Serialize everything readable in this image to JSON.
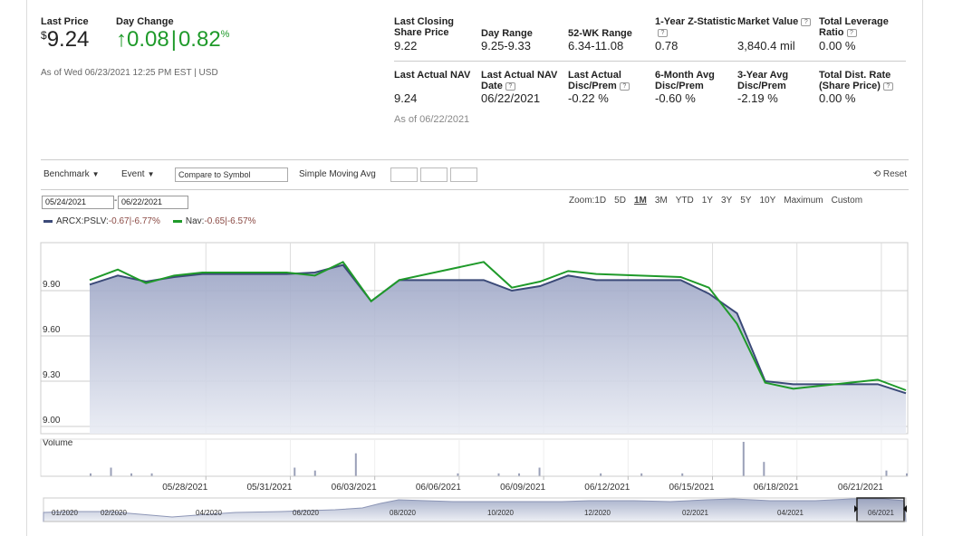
{
  "quote": {
    "last_price_label": "Last Price",
    "currency_symbol": "$",
    "last_price": "9.24",
    "day_change_label": "Day Change",
    "day_change_value": "0.08",
    "day_change_pct": "0.82",
    "day_change_pct_sign": "%",
    "as_of": "As of Wed 06/23/2021 12:25 PM EST | USD",
    "colors": {
      "positive": "#1f9a2a"
    }
  },
  "stats_row1": [
    {
      "label": "Last Closing Share Price",
      "value": "9.22",
      "help": false
    },
    {
      "label": "Day Range",
      "value": "9.25-9.33",
      "help": false
    },
    {
      "label": "52-WK Range",
      "value": "6.34-11.08",
      "help": false
    },
    {
      "label": "1-Year Z-Statistic",
      "value": "0.78",
      "help": true
    },
    {
      "label": "Market Value",
      "value": "3,840.4 mil",
      "help": true
    },
    {
      "label": "Total Leverage Ratio",
      "value": "0.00 %",
      "help": true
    }
  ],
  "stats_row2": [
    {
      "label": "Last Actual NAV",
      "value": "9.24",
      "help": false
    },
    {
      "label": "Last Actual NAV Date",
      "value": "06/22/2021",
      "help": true
    },
    {
      "label": "Last Actual Disc/Prem",
      "value": "-0.22 %",
      "help": true
    },
    {
      "label": "6-Month Avg Disc/Prem",
      "value": "-0.60 %",
      "help": false
    },
    {
      "label": "3-Year Avg Disc/Prem",
      "value": "-2.19 %",
      "help": false
    },
    {
      "label": "Total Dist. Rate (Share Price)",
      "value": "0.00 %",
      "help": true
    }
  ],
  "nav_as_of": "As of 06/22/2021",
  "toolbar": {
    "benchmark": "Benchmark",
    "event": "Event",
    "compare_placeholder": "Compare to Symbol",
    "sma": "Simple Moving Avg",
    "reset": "Reset"
  },
  "date_range": {
    "from": "05/24/2021",
    "to": "06/22/2021"
  },
  "zoom": {
    "label": "Zoom:",
    "options": [
      "1D",
      "5D",
      "1M",
      "3M",
      "YTD",
      "1Y",
      "3Y",
      "5Y",
      "10Y",
      "Maximum",
      "Custom"
    ],
    "active": "1M"
  },
  "legend": [
    {
      "name": "ARCX:PSLV:",
      "value": "-0.67|-6.77%",
      "color": "#3b4a78"
    },
    {
      "name": "Nav:",
      "value": "-0.65|-6.57%",
      "color": "#1f9a2a"
    }
  ],
  "volume_label": "Volume",
  "chart_data": {
    "type": "line",
    "ylim": [
      9.0,
      10.15
    ],
    "yticks": [
      "9.90",
      "9.60",
      "9.30",
      "9.00"
    ],
    "x_tick_labels": [
      "05/28/2021",
      "05/31/2021",
      "06/03/2021",
      "06/06/2021",
      "06/09/2021",
      "06/12/2021",
      "06/15/2021",
      "06/18/2021",
      "06/21/2021"
    ],
    "x_tick_days": [
      4,
      7,
      10,
      13,
      16,
      19,
      22,
      25,
      28
    ],
    "x": [
      0,
      1,
      2,
      3,
      4,
      7,
      8,
      9,
      10,
      11,
      14,
      15,
      16,
      17,
      18,
      21,
      22,
      23,
      24,
      25,
      28,
      29
    ],
    "series": [
      {
        "name": "ARCX:PSLV",
        "values": [
          9.94,
          10.0,
          9.96,
          9.99,
          10.01,
          10.01,
          10.02,
          10.07,
          9.83,
          9.97,
          9.97,
          9.9,
          9.93,
          10.0,
          9.97,
          9.97,
          9.88,
          9.75,
          9.3,
          9.28,
          9.28,
          9.22
        ]
      },
      {
        "name": "Nav",
        "values": [
          9.97,
          10.04,
          9.95,
          10.0,
          10.02,
          10.02,
          10.0,
          10.09,
          9.83,
          9.97,
          10.09,
          9.92,
          9.96,
          10.03,
          10.01,
          9.99,
          9.92,
          9.68,
          9.29,
          9.25,
          9.31,
          9.24
        ]
      }
    ],
    "volume": [
      1,
      3,
      1,
      1,
      0,
      0,
      0,
      0,
      0,
      0,
      3,
      2,
      0,
      8,
      0,
      0,
      0,
      0,
      1,
      0,
      1,
      1,
      3,
      0,
      0,
      1,
      0,
      1,
      0,
      1,
      0,
      0,
      12,
      5,
      0,
      0,
      0,
      0,
      0,
      2,
      1
    ],
    "navigator_labels": [
      "01/2020",
      "02/2020",
      "04/2020",
      "06/2020",
      "08/2020",
      "10/2020",
      "12/2020",
      "02/2021",
      "04/2021",
      "06/2021"
    ]
  }
}
